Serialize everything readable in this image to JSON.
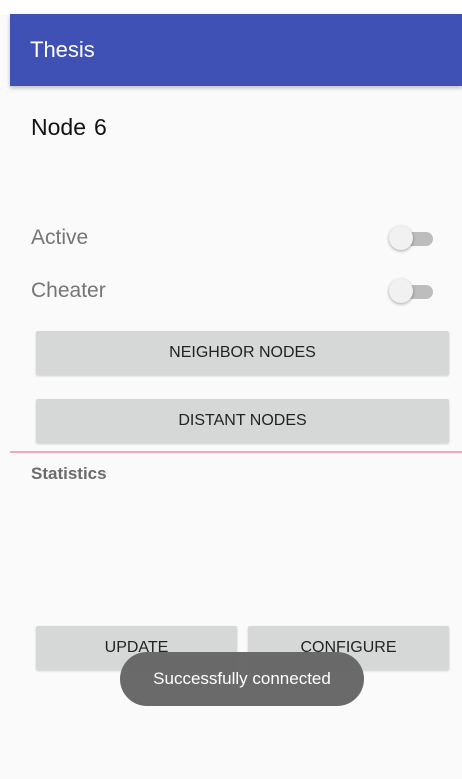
{
  "app_bar": {
    "title": "Thesis",
    "color": "#3f51b5"
  },
  "node": {
    "label": "Node",
    "number": "6"
  },
  "switches": {
    "active": {
      "label": "Active",
      "checked": false
    },
    "cheater": {
      "label": "Cheater",
      "checked": false
    }
  },
  "buttons": {
    "neighbor_nodes": "NEIGHBOR NODES",
    "distant_nodes": "DISTANT NODES",
    "update": "UPDATE",
    "configure": "CONFIGURE"
  },
  "statistics": {
    "label": "Statistics"
  },
  "toast": {
    "message": "Successfully connected"
  },
  "colors": {
    "divider": "#f2a4c4",
    "button_bg": "#d6d7d7",
    "screen_bg": "#fafafa"
  }
}
